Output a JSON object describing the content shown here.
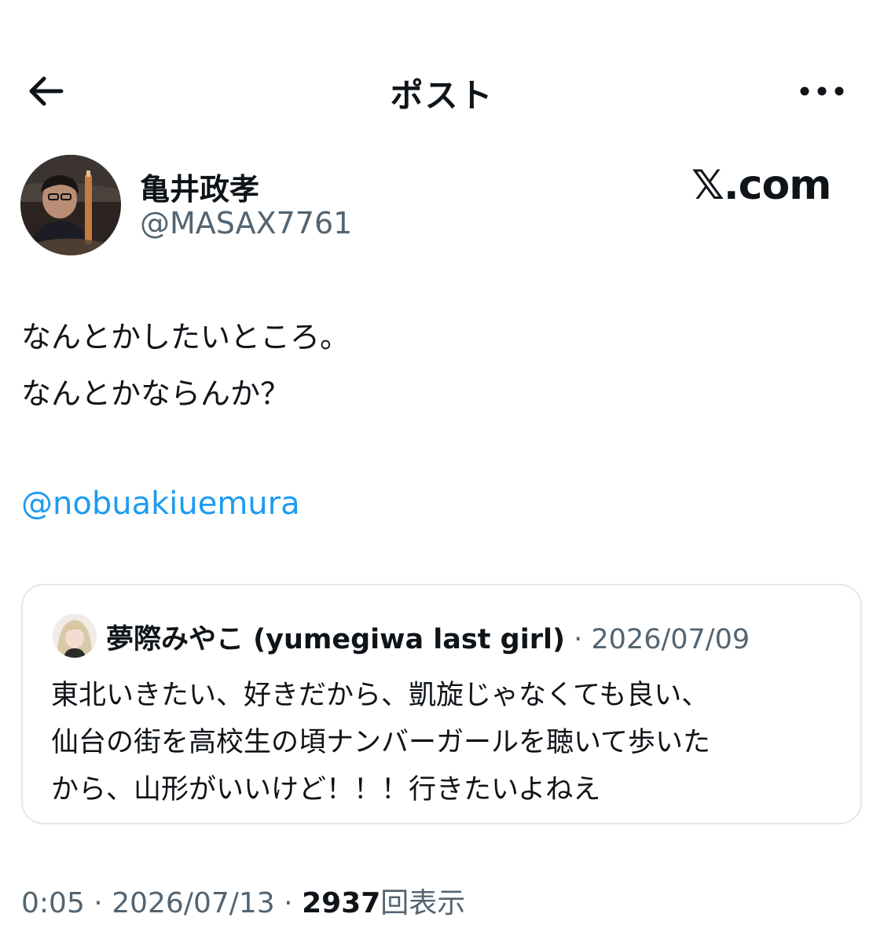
{
  "header": {
    "title": "ポスト",
    "back_icon": "arrow-left-icon",
    "more_icon": "more-horizontal-icon"
  },
  "author": {
    "name": "亀井政孝",
    "handle": "@MASAX7761"
  },
  "watermark": "𝕏.com",
  "post": {
    "lines": [
      "なんとかしたいところ。",
      "なんとかならんか？"
    ],
    "mention": "@nobuakiuemura"
  },
  "quote": {
    "author_name": "夢際みやこ (yumegiwa last girl)",
    "separator": "·",
    "date": "2026/07/09",
    "lines": [
      "東北いきたい、好きだから、凱旋じゃなくても良い、",
      "仙台の街を高校生の頃ナンバーガールを聴いて歩いた",
      "から、山形がいいけど！！！行きたいよねえ"
    ]
  },
  "meta": {
    "time": "0:05",
    "sep1": "·",
    "date": "2026/07/13",
    "sep2": "·",
    "views_count": "2937",
    "views_label": "回表示"
  },
  "colors": {
    "text": "#0f1419",
    "secondary": "#536471",
    "link": "#1d9bf0",
    "border": "#e1e8ed"
  }
}
